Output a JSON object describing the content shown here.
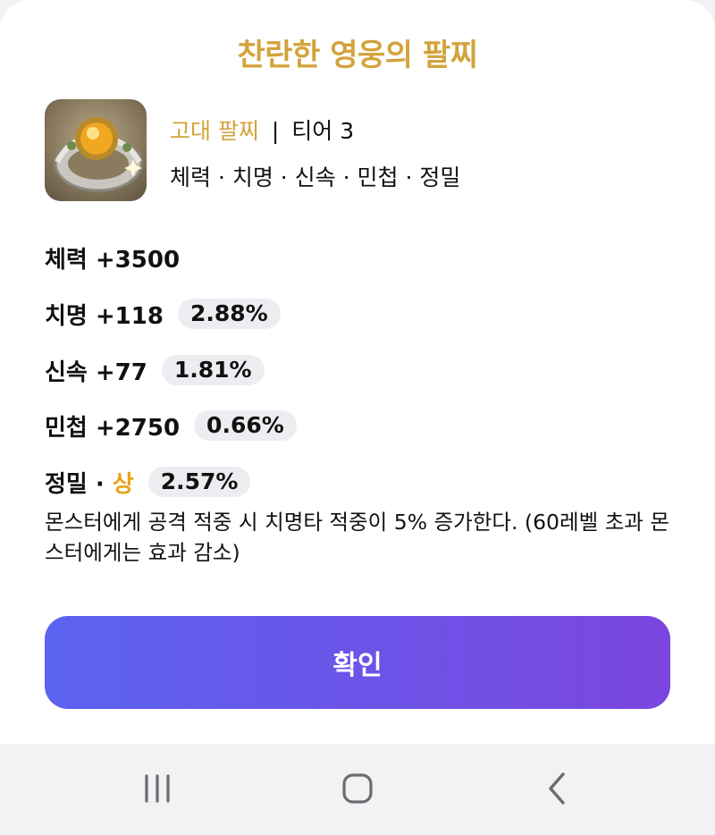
{
  "colors": {
    "gold": "#d3a33c",
    "accent_start": "#5b63f0",
    "accent_end": "#7b46e0",
    "chip_bg": "#ebedf1"
  },
  "dialog": {
    "title": "찬란한 영웅의 팔찌",
    "item_icon": "bracelet-icon",
    "type": "고대 팔찌",
    "separator": "|",
    "tier": "티어 3",
    "stat_summary": "체력 · 치명 · 신속 · 민첩 · 정밀"
  },
  "stats": [
    {
      "label": "체력 +3500"
    },
    {
      "label": "치명 +118",
      "percent": "2.88%"
    },
    {
      "label": "신속 +77",
      "percent": "1.81%"
    },
    {
      "label": "민첩 +2750",
      "percent": "0.66%"
    },
    {
      "label": "정밀 · ",
      "grade": "상",
      "percent": "2.57%"
    }
  ],
  "description": "몬스터에게 공격 적중 시 치명타 적중이 5% 증가한다. (60레벨 초과 몬스터에게는 효과 감소)",
  "confirm_label": "확인",
  "navbar": {
    "recents": "recents-icon",
    "home": "home-icon",
    "back": "back-icon"
  }
}
